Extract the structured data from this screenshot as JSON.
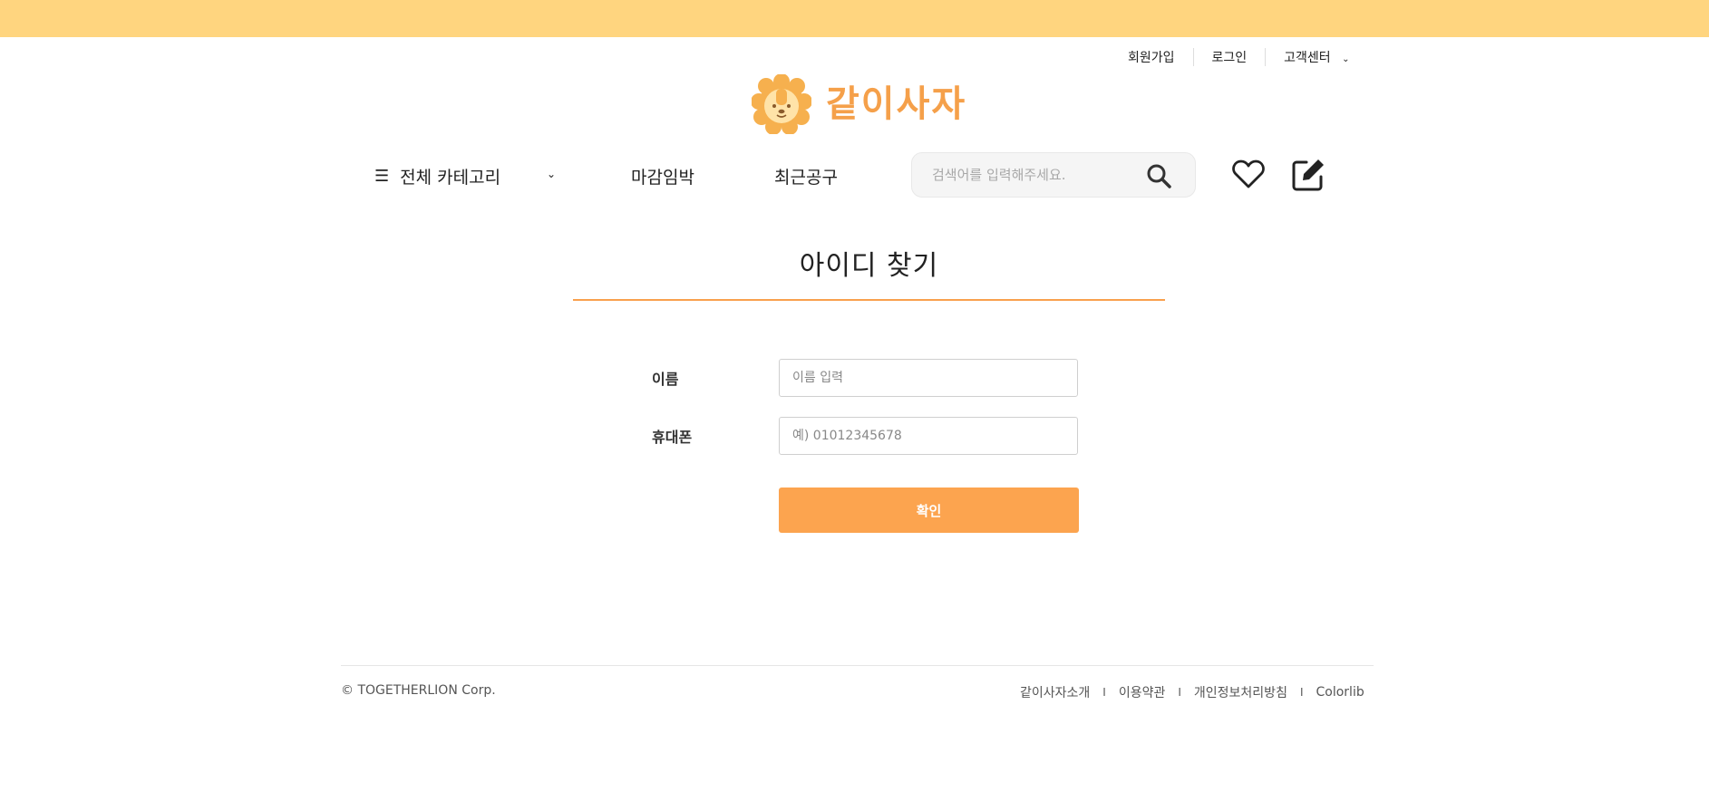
{
  "util_nav": {
    "signup": "회원가입",
    "login": "로그인",
    "support": "고객센터"
  },
  "logo": {
    "text": "같이사자"
  },
  "nav": {
    "category": "전체 카테고리",
    "deadline": "마감임박",
    "recent": "최근공구"
  },
  "search": {
    "placeholder": "검색어를 입력해주세요."
  },
  "page": {
    "title": "아이디 찾기"
  },
  "form": {
    "name_label": "이름",
    "name_placeholder": "이름 입력",
    "phone_label": "휴대폰",
    "phone_placeholder": "예) 01012345678",
    "confirm": "확인"
  },
  "footer": {
    "copyright": "© TOGETHERLION Corp.",
    "links": [
      "같이사자소개",
      "이용약관",
      "개인정보처리방침",
      "Colorlib"
    ],
    "separator": "I"
  },
  "colors": {
    "topbar": "#ffd57f",
    "accent": "#fca44f",
    "logo_text": "#f5a04a"
  },
  "icons": [
    "menu-icon",
    "chevron-down-icon",
    "search-icon",
    "heart-icon",
    "edit-icon",
    "lion-logo-icon"
  ]
}
